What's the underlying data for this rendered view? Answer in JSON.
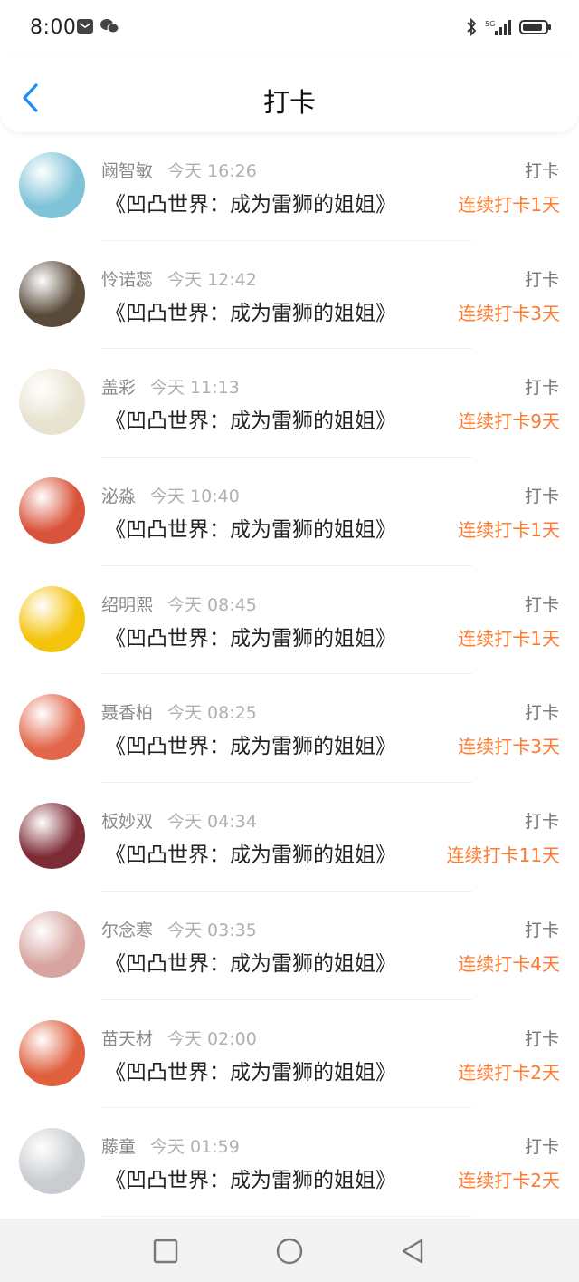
{
  "status": {
    "time": "8:00",
    "network": "5G"
  },
  "header": {
    "title": "打卡"
  },
  "items": [
    {
      "name": "阚智敏",
      "time": "今天 16:26",
      "book": "《凹凸世界：成为雷狮的姐姐》",
      "tag": "打卡",
      "streak": "连续打卡1天",
      "avatar_color": "#7fc3d8"
    },
    {
      "name": "怜诺蕊",
      "time": "今天 12:42",
      "book": "《凹凸世界：成为雷狮的姐姐》",
      "tag": "打卡",
      "streak": "连续打卡3天",
      "avatar_color": "#5a4a3a"
    },
    {
      "name": "盖彩",
      "time": "今天 11:13",
      "book": "《凹凸世界：成为雷狮的姐姐》",
      "tag": "打卡",
      "streak": "连续打卡9天",
      "avatar_color": "#e8e3d0"
    },
    {
      "name": "泌淼",
      "time": "今天 10:40",
      "book": "《凹凸世界：成为雷狮的姐姐》",
      "tag": "打卡",
      "streak": "连续打卡1天",
      "avatar_color": "#d9533a"
    },
    {
      "name": "绍明熙",
      "time": "今天 08:45",
      "book": "《凹凸世界：成为雷狮的姐姐》",
      "tag": "打卡",
      "streak": "连续打卡1天",
      "avatar_color": "#f4c30c"
    },
    {
      "name": "聂香柏",
      "time": "今天 08:25",
      "book": "《凹凸世界：成为雷狮的姐姐》",
      "tag": "打卡",
      "streak": "连续打卡3天",
      "avatar_color": "#e2674a"
    },
    {
      "name": "板妙双",
      "time": "今天 04:34",
      "book": "《凹凸世界：成为雷狮的姐姐》",
      "tag": "打卡",
      "streak": "连续打卡11天",
      "avatar_color": "#7d2b35"
    },
    {
      "name": "尔念寒",
      "time": "今天 03:35",
      "book": "《凹凸世界：成为雷狮的姐姐》",
      "tag": "打卡",
      "streak": "连续打卡4天",
      "avatar_color": "#d7a49f"
    },
    {
      "name": "苗天材",
      "time": "今天 02:00",
      "book": "《凹凸世界：成为雷狮的姐姐》",
      "tag": "打卡",
      "streak": "连续打卡2天",
      "avatar_color": "#e0603e"
    },
    {
      "name": "藤童",
      "time": "今天 01:59",
      "book": "《凹凸世界：成为雷狮的姐姐》",
      "tag": "打卡",
      "streak": "连续打卡2天",
      "avatar_color": "#c9ccd0"
    }
  ],
  "colors": {
    "accent": "#ff7a2f",
    "back": "#1a8cff"
  }
}
